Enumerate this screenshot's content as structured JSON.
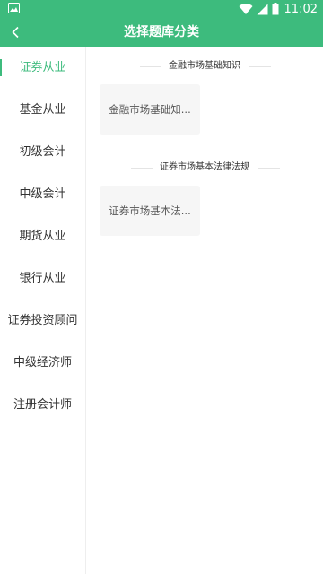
{
  "status_bar": {
    "time": "11:02"
  },
  "header": {
    "title": "选择题库分类"
  },
  "sidebar": {
    "items": [
      {
        "label": "证券从业"
      },
      {
        "label": "基金从业"
      },
      {
        "label": "初级会计"
      },
      {
        "label": "中级会计"
      },
      {
        "label": "期货从业"
      },
      {
        "label": "银行从业"
      },
      {
        "label": "证券投资顾问"
      },
      {
        "label": "中级经济师"
      },
      {
        "label": "注册会计师"
      }
    ]
  },
  "sections": [
    {
      "title": "金融市场基础知识",
      "card": "金融市场基础知..."
    },
    {
      "title": "证券市场基本法律法规",
      "card": "证券市场基本法..."
    }
  ],
  "colors": {
    "accent": "#3dbb7d",
    "card_bg": "#f6f6f6"
  }
}
